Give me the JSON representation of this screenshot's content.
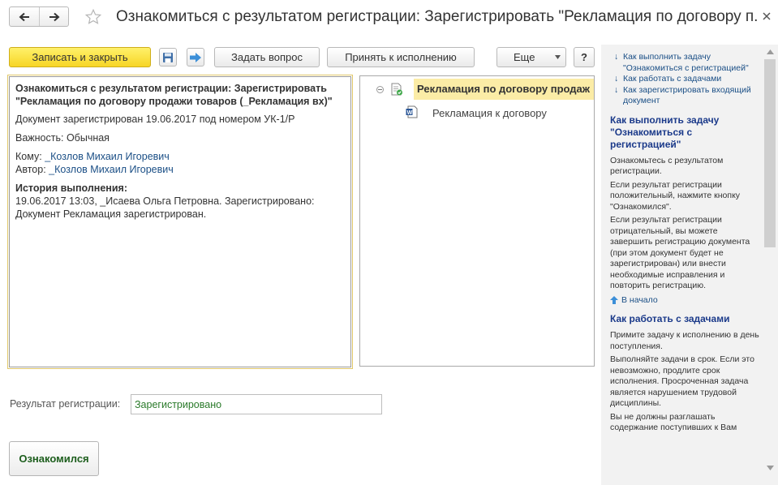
{
  "window": {
    "title": "Ознакомиться с результатом регистрации: Зарегистрировать \"Рекламация по договору п..."
  },
  "toolbar": {
    "save_close_label": "Записать и закрыть",
    "ask_question_label": "Задать вопрос",
    "accept_label": "Принять к исполнению",
    "more_label": "Еще",
    "help_label": "?"
  },
  "description": {
    "title": "Ознакомиться с результатом регистрации: Зарегистрировать \"Рекламация по договору продажи товаров (_Рекламация вх)\"",
    "registered_text": "Документ зарегистрирован 19.06.2017 под номером УК-1/Р",
    "importance_label": "Важность:",
    "importance_value": "Обычная",
    "to_label": "Кому:",
    "to_value": "_Козлов Михаил Игоревич",
    "author_label": "Автор:",
    "author_value": "_Козлов Михаил Игоревич",
    "history_title": "История выполнения:",
    "history_text": "19.06.2017 13:03, _Исаева Ольга Петровна. Зарегистрировано: Документ Рекламация зарегистрирован."
  },
  "tree": {
    "root_label": "Рекламация по договору продаж",
    "child_label": "Рекламация к договору"
  },
  "result": {
    "label": "Результат регистрации:",
    "value": "Зарегистрировано"
  },
  "acknowledge_button": "Ознакомился",
  "help": {
    "links": [
      "Как выполнить задачу \"Ознакомиться с регистрацией\"",
      "Как работать с задачами",
      "Как зарегистрировать входящий документ"
    ],
    "section1_title": "Как выполнить задачу \"Ознакомиться с регистрацией\"",
    "section1_p1": "Ознакомьтесь с результатом регистрации.",
    "section1_p2": "Если результат регистрации положительный, нажмите кнопку \"Ознакомился\".",
    "section1_p3": "Если результат регистрации отрицательный, вы можете завершить регистрацию документа (при этом документ будет не зарегистрирован) или внести необходимые исправления и повторить регистрацию.",
    "to_top": "В начало",
    "section2_title": "Как работать с задачами",
    "section2_p1": "Примите задачу к исполнению в день поступления.",
    "section2_p2": "Выполняйте задачи в срок. Если это невозможно, продлите срок исполнения. Просроченная задача является нарушением трудовой дисциплины.",
    "section2_p3": "Вы не должны разглашать содержание поступивших к Вам"
  },
  "colors": {
    "primary_button": "#f7d526",
    "selection": "#fbeca6",
    "link": "#1b4f86",
    "result_text": "#2a7a2a"
  }
}
